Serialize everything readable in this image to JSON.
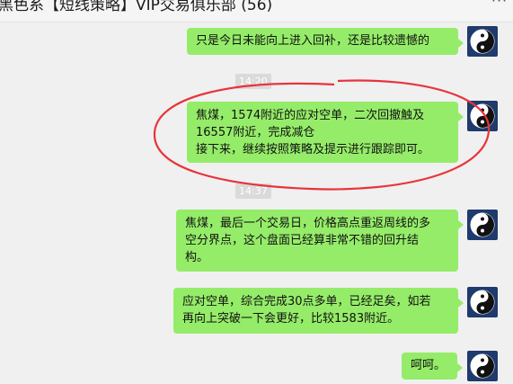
{
  "window": {
    "title": "黑色系【短线策略】VIP交易俱乐部 (56)",
    "more_glyph": "···"
  },
  "chat": {
    "messages": [
      {
        "lines": [
          "只是今日未能向上进入回补，还是比较遗憾的"
        ]
      },
      {
        "lines": [
          "焦煤，1574附近的应对空单，二次回撤触及",
          "16557附近，完成减仓",
          "接下来，继续按照策略及提示进行跟踪即可。"
        ]
      },
      {
        "lines": [
          "焦煤，最后一个交易日，价格高点重返周线的多",
          "空分界点，这个盘面已经算非常不错的回升结",
          "构。"
        ]
      },
      {
        "lines": [
          "应对空单，综合完成30点多单，已经足矣，如若",
          "再向上突破一下会更好，比较1583附近。"
        ]
      },
      {
        "lines": [
          "呵呵。"
        ]
      }
    ],
    "timestamps": [
      "14:20",
      "14:37"
    ]
  },
  "colors": {
    "bubble_green": "#95ec69",
    "avatar_bg": "#1f3a6d",
    "annotation_red": "#e8343b",
    "background": "#f0f0f0"
  },
  "icons": {
    "avatar": "yin-yang-icon",
    "more": "more-icon"
  }
}
